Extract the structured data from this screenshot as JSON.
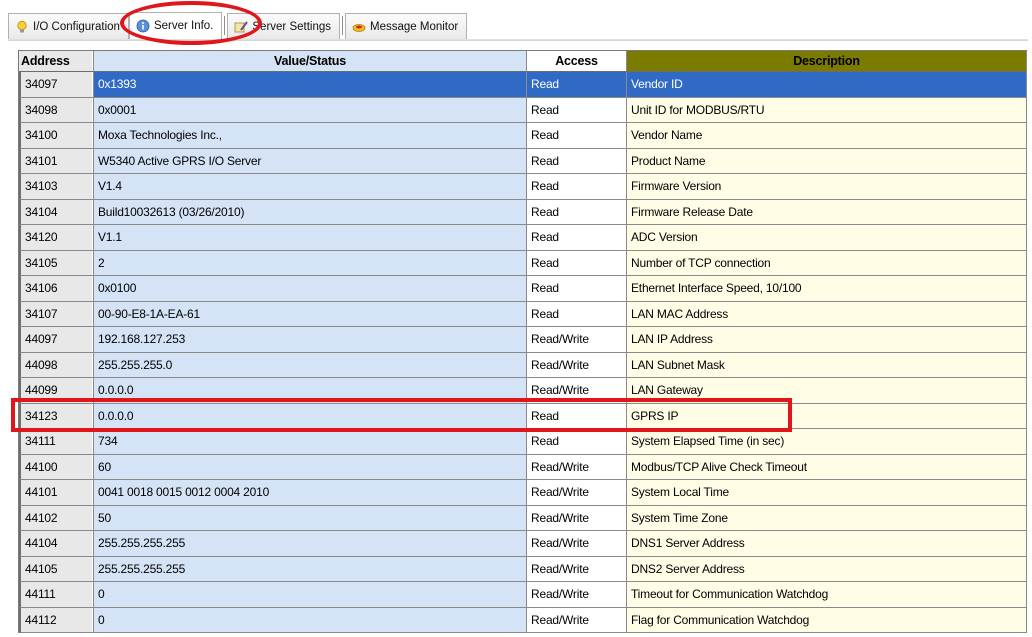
{
  "tabs": [
    {
      "label": "I/O Configuration",
      "icon": "lightbulb-icon",
      "active": false
    },
    {
      "label": "Server Info.",
      "icon": "info-globe-icon",
      "active": true
    },
    {
      "label": "Server Settings",
      "icon": "settings-wrench-icon",
      "active": false
    },
    {
      "label": "Message Monitor",
      "icon": "message-icon",
      "active": false
    }
  ],
  "table": {
    "headers": {
      "address": "Address",
      "value": "Value/Status",
      "access": "Access",
      "description": "Description"
    },
    "rows": [
      {
        "address": "34097",
        "value": "0x1393",
        "access": "Read",
        "description": "Vendor ID"
      },
      {
        "address": "34098",
        "value": "0x0001",
        "access": "Read",
        "description": "Unit ID for MODBUS/RTU"
      },
      {
        "address": "34100",
        "value": "Moxa Technologies Inc.,",
        "access": "Read",
        "description": "Vendor Name"
      },
      {
        "address": "34101",
        "value": "W5340 Active GPRS I/O Server",
        "access": "Read",
        "description": "Product Name"
      },
      {
        "address": "34103",
        "value": "V1.4",
        "access": "Read",
        "description": "Firmware Version"
      },
      {
        "address": "34104",
        "value": "Build10032613 (03/26/2010)",
        "access": "Read",
        "description": "Firmware Release Date"
      },
      {
        "address": "34120",
        "value": "V1.1",
        "access": "Read",
        "description": "ADC Version"
      },
      {
        "address": "34105",
        "value": "2",
        "access": "Read",
        "description": "Number of TCP connection"
      },
      {
        "address": "34106",
        "value": "0x0100",
        "access": "Read",
        "description": "Ethernet Interface Speed, 10/100"
      },
      {
        "address": "34107",
        "value": "00-90-E8-1A-EA-61",
        "access": "Read",
        "description": "LAN MAC Address"
      },
      {
        "address": "44097",
        "value": "192.168.127.253",
        "access": "Read/Write",
        "description": "LAN IP Address"
      },
      {
        "address": "44098",
        "value": "255.255.255.0",
        "access": "Read/Write",
        "description": "LAN Subnet Mask"
      },
      {
        "address": "44099",
        "value": "0.0.0.0",
        "access": "Read/Write",
        "description": "LAN Gateway"
      },
      {
        "address": "34123",
        "value": "0.0.0.0",
        "access": "Read",
        "description": "GPRS IP"
      },
      {
        "address": "34111",
        "value": "734",
        "access": "Read",
        "description": "System Elapsed Time (in sec)"
      },
      {
        "address": "44100",
        "value": "60",
        "access": "Read/Write",
        "description": "Modbus/TCP Alive Check Timeout"
      },
      {
        "address": "44101",
        "value": "0041 0018 0015 0012 0004 2010",
        "access": "Read/Write",
        "description": "System Local Time"
      },
      {
        "address": "44102",
        "value": "50",
        "access": "Read/Write",
        "description": "System Time Zone"
      },
      {
        "address": "44104",
        "value": "255.255.255.255",
        "access": "Read/Write",
        "description": "DNS1 Server Address"
      },
      {
        "address": "44105",
        "value": "255.255.255.255",
        "access": "Read/Write",
        "description": "DNS2 Server Address"
      },
      {
        "address": "44111",
        "value": "0",
        "access": "Read/Write",
        "description": "Timeout for Communication Watchdog"
      },
      {
        "address": "44112",
        "value": "0",
        "access": "Read/Write",
        "description": "Flag for Communication Watchdog"
      }
    ],
    "selected_row_index": 0
  },
  "colors": {
    "selection": "#316ac5",
    "value_column": "#d5e3f6",
    "description_column": "#fffde6",
    "description_header": "#7b7b00",
    "annotation_red": "#e0161b"
  }
}
